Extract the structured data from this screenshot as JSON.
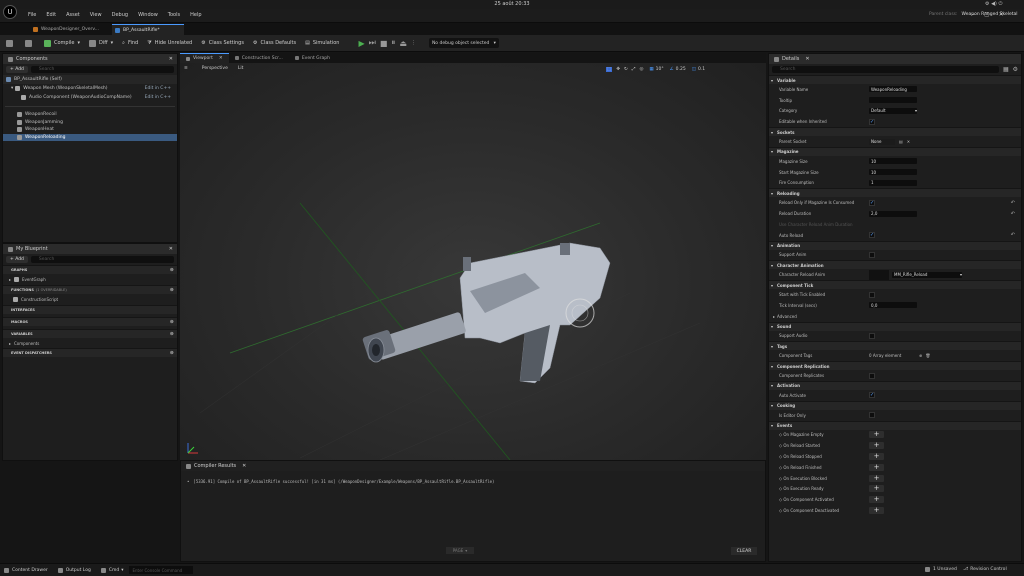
{
  "system": {
    "datetime": "25 août  20:33"
  },
  "menu": [
    "File",
    "Edit",
    "Asset",
    "View",
    "Debug",
    "Window",
    "Tools",
    "Help"
  ],
  "parent_class": {
    "label": "Parent class:",
    "value": "Weapon Ranged Skeletal"
  },
  "tabs": [
    "WeaponDesigner_Overv...",
    "BP_AssaultRifle*"
  ],
  "toolbar": {
    "compile": "Compile",
    "diff": "Diff",
    "find": "Find",
    "hide_unrelated": "Hide Unrelated",
    "class_settings": "Class Settings",
    "class_defaults": "Class Defaults",
    "simulation": "Simulation",
    "debug_select": "No debug object selected"
  },
  "components": {
    "title": "Components",
    "add": "+ Add",
    "search_placeholder": "Search",
    "root": "BP_AssaultRifle (Self)",
    "items": [
      {
        "label": "Weapon Mesh (WeaponSkeletalMesh)",
        "edit": "Edit in C++"
      },
      {
        "label": "Audio Component (WeaponAudioCompName)",
        "edit": "Edit in C++"
      }
    ],
    "others": [
      "WeaponRecoil",
      "WeaponJamming",
      "WeaponHeat",
      "WeaponReloading"
    ]
  },
  "my_blueprint": {
    "title": "My Blueprint",
    "add": "+ Add",
    "search_placeholder": "Search",
    "graphs": "GRAPHS",
    "event_graph": "EventGraph",
    "functions": "FUNCTIONS",
    "functions_count": "(1 OVERRIDABLE)",
    "construction": "ConstructionScript",
    "interfaces": "INTERFACES",
    "macros": "MACROS",
    "variables": "VARIABLES",
    "components": "Components",
    "dispatchers": "EVENT DISPATCHERS"
  },
  "viewport": {
    "tabs": [
      "Viewport",
      "Construction Scr...",
      "Event Graph"
    ],
    "perspective": "Perspective",
    "lit": "Lit",
    "fov": "10°",
    "scale": "0.25",
    "speed": "0.1"
  },
  "compiler": {
    "title": "Compiler Results",
    "message": "[5336.91] Compile of BP_AssaultRifle successful! [in 31 ms] (/WeaponDesigner/Example/Weapons/BP_AssaultRifle.BP_AssaultRifle)",
    "page": "PAGE",
    "clear": "CLEAR"
  },
  "details": {
    "title": "Details",
    "search_placeholder": "Search",
    "sections": [
      {
        "type": "section",
        "label": "Variable"
      },
      {
        "type": "field",
        "label": "Variable Name",
        "value": "WeaponReloading"
      },
      {
        "type": "field",
        "label": "Tooltip",
        "value": ""
      },
      {
        "type": "select",
        "label": "Category",
        "value": "Default"
      },
      {
        "type": "check",
        "label": "Editable when Inherited",
        "on": true
      },
      {
        "type": "section",
        "label": "Sockets"
      },
      {
        "type": "socket",
        "label": "Parent Socket",
        "value": "None"
      },
      {
        "type": "section",
        "label": "Magazine"
      },
      {
        "type": "field",
        "label": "Magazine Size",
        "value": "10"
      },
      {
        "type": "field",
        "label": "Start Magazine Size",
        "value": "10"
      },
      {
        "type": "field",
        "label": "Fire Consumption",
        "value": "1"
      },
      {
        "type": "section",
        "label": "Reloading"
      },
      {
        "type": "check",
        "label": "Reload Only if Magazine Is Consumed",
        "on": true,
        "reset": true
      },
      {
        "type": "field",
        "label": "Reload Duration",
        "value": "2,0",
        "reset": true
      },
      {
        "type": "field",
        "label": "Use Character Reload Anim Duration",
        "value": "",
        "dim": true
      },
      {
        "type": "check",
        "label": "Auto Reload",
        "on": true,
        "reset": true
      },
      {
        "type": "section",
        "label": "Animation"
      },
      {
        "type": "check",
        "label": "Support Anim",
        "on": false
      },
      {
        "type": "section",
        "label": "Character Animation"
      },
      {
        "type": "anim",
        "label": "Character Reload Anim",
        "value": "MM_Rifle_Reload"
      },
      {
        "type": "section",
        "label": "Component Tick"
      },
      {
        "type": "check",
        "label": "Start with Tick Enabled",
        "on": false
      },
      {
        "type": "field",
        "label": "Tick Interval (secs)",
        "value": "0,0"
      },
      {
        "type": "collapse",
        "label": "Advanced"
      },
      {
        "type": "section",
        "label": "Sound"
      },
      {
        "type": "check",
        "label": "Support Audio",
        "on": false
      },
      {
        "type": "section",
        "label": "Tags"
      },
      {
        "type": "tags",
        "label": "Component Tags",
        "value": "0 Array element"
      },
      {
        "type": "section",
        "label": "Component Replication"
      },
      {
        "type": "check",
        "label": "Component Replicates",
        "on": false
      },
      {
        "type": "section",
        "label": "Activation"
      },
      {
        "type": "check",
        "label": "Auto Activate",
        "on": true
      },
      {
        "type": "section",
        "label": "Cooking"
      },
      {
        "type": "check",
        "label": "Is Editor Only",
        "on": false
      },
      {
        "type": "section",
        "label": "Events"
      },
      {
        "type": "event",
        "label": "On Magazine Empty"
      },
      {
        "type": "event",
        "label": "On Reload Started"
      },
      {
        "type": "event",
        "label": "On Reload Stopped"
      },
      {
        "type": "event",
        "label": "On Reload Finished"
      },
      {
        "type": "event",
        "label": "On Execution Blocked"
      },
      {
        "type": "event",
        "label": "On Execution Ready"
      },
      {
        "type": "event",
        "label": "On Component Activated"
      },
      {
        "type": "event",
        "label": "On Component Deactivated"
      }
    ]
  },
  "status": {
    "content_drawer": "Content Drawer",
    "output_log": "Output Log",
    "cmd": "Cmd",
    "console_placeholder": "Enter Console Command",
    "unsaved": "1 Unsaved",
    "revision": "Revision Control"
  },
  "colors": {
    "accent": "#4a9aff",
    "play": "#4caf50",
    "selected": "#3a5a80"
  }
}
